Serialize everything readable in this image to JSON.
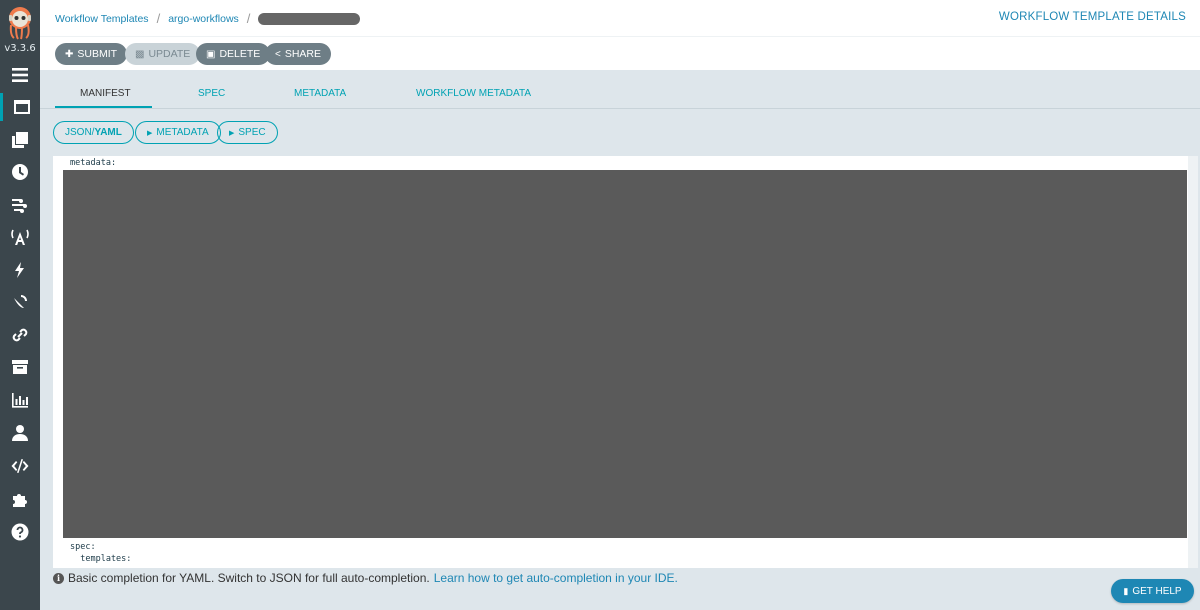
{
  "app": {
    "version": "v3.3.6",
    "accent": "#00a2b3",
    "link_color": "#1e87b4",
    "sidebar_bg": "#3b464c"
  },
  "sidebar": {
    "items": [
      {
        "icon": "bars-icon"
      },
      {
        "icon": "window-icon"
      },
      {
        "icon": "clone-icon"
      },
      {
        "icon": "clock-icon"
      },
      {
        "icon": "stream-icon"
      },
      {
        "icon": "broadcast-tower-icon"
      },
      {
        "icon": "bolt-icon"
      },
      {
        "icon": "satellite-dish-icon"
      },
      {
        "icon": "link-icon"
      },
      {
        "icon": "archive-icon"
      },
      {
        "icon": "chart-bar-icon"
      },
      {
        "icon": "user-icon"
      },
      {
        "icon": "code-icon"
      },
      {
        "icon": "puzzle-piece-icon"
      },
      {
        "icon": "question-circle-icon"
      }
    ]
  },
  "breadcrumb": {
    "items": [
      "Workflow Templates",
      "argo-workflows"
    ],
    "separator": "/"
  },
  "header": {
    "title": "WORKFLOW TEMPLATE DETAILS"
  },
  "toolbar": {
    "submit": "SUBMIT",
    "update": "UPDATE",
    "delete": "DELETE",
    "share": "SHARE"
  },
  "tabs": {
    "items": [
      "MANIFEST",
      "SPEC",
      "METADATA",
      "WORKFLOW METADATA"
    ],
    "active": "MANIFEST"
  },
  "pills": {
    "format_prefix": "JSON/",
    "format_active": "YAML",
    "metadata": "METADATA",
    "spec": "SPEC"
  },
  "editor": {
    "line1": "metadata:",
    "line2": "spec:",
    "line3": "  templates:"
  },
  "hint": {
    "text": "Basic completion for YAML. Switch to JSON for full auto-completion.",
    "link": "Learn how to get auto-completion in your IDE."
  },
  "help": {
    "label": "GET HELP"
  }
}
